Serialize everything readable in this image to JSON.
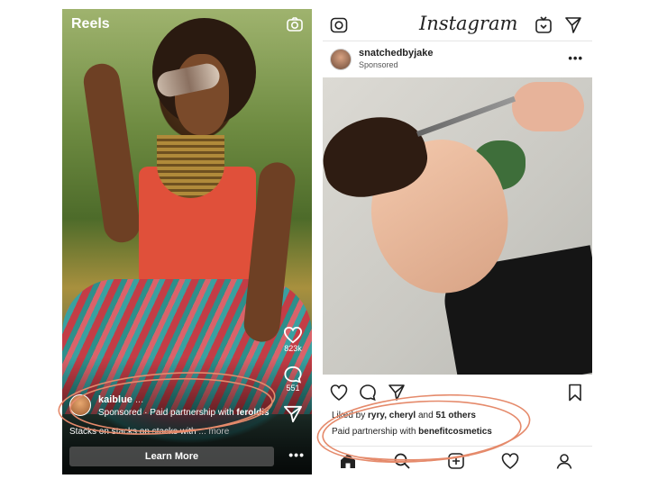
{
  "reels": {
    "title": "Reels",
    "likes": "823k",
    "comments": "551",
    "username": "kaiblue",
    "username_suffix": "...",
    "sponsored_prefix": "Sponsored · Paid partnership with ",
    "partner": "feroldis",
    "caption": "Stacks on stacks on stacks with ",
    "caption_more": "... more",
    "cta": "Learn More",
    "more": "•••"
  },
  "post": {
    "logo": "Instagram",
    "username": "snatchedbyjake",
    "sponsored": "Sponsored",
    "options": "•••",
    "liked_prefix": "Liked by ",
    "liked_names": "ryry, cheryl",
    "liked_and": " and ",
    "liked_count": "51 others",
    "paid_prefix": "Paid partnership with ",
    "partner": "benefitcosmetics"
  },
  "colors": {
    "annotation": "#e58a6b"
  }
}
